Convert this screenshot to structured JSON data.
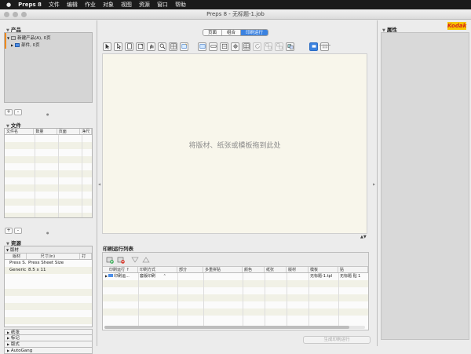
{
  "menubar": {
    "apple": "",
    "app": "Preps 8",
    "items": [
      "文件",
      "编辑",
      "作业",
      "对象",
      "视图",
      "资源",
      "窗口",
      "帮助"
    ]
  },
  "window_title": "Preps 8 - 无标题-1.job",
  "left": {
    "products": {
      "title": "产品",
      "tree": [
        {
          "label": "新建产品(A), 0页"
        },
        {
          "label": "部件, 0页"
        }
      ]
    },
    "files": {
      "title": "文件",
      "columns": [
        "文件名",
        "数量",
        "页面",
        "净尺"
      ]
    },
    "resources": {
      "title": "资源",
      "sheet_group": "版材",
      "columns": [
        "版材",
        "尺寸(in)",
        "打"
      ],
      "rows": [
        {
          "name": "Press S...",
          "size": "Press Sheet Size"
        },
        {
          "name": "Generic...",
          "size": "8.5 x 11"
        }
      ],
      "bottom_tabs": [
        "纸张",
        "标记",
        "版式",
        "AutoGang"
      ]
    }
  },
  "center": {
    "tabs": [
      "页面",
      "组合",
      "印刷运行"
    ],
    "active_tab": "印刷运行",
    "canvas_hint": "将版材、纸张或模板拖到此处",
    "run_list": {
      "title": "印刷运行列表",
      "columns": [
        "印刷运行 ↑",
        "印刷方式",
        "部分",
        "多重拼贴",
        "颜色",
        "纸张",
        "版材",
        "模板",
        "贴"
      ],
      "rows": [
        {
          "run": "印刷运...",
          "method": "套版印刷",
          "template": "无标题-1.tpl",
          "signature": "无标题 贴 1"
        }
      ]
    },
    "bottom_button": "生成印刷运行"
  },
  "right": {
    "title": "属性",
    "brand": "Kodak"
  }
}
